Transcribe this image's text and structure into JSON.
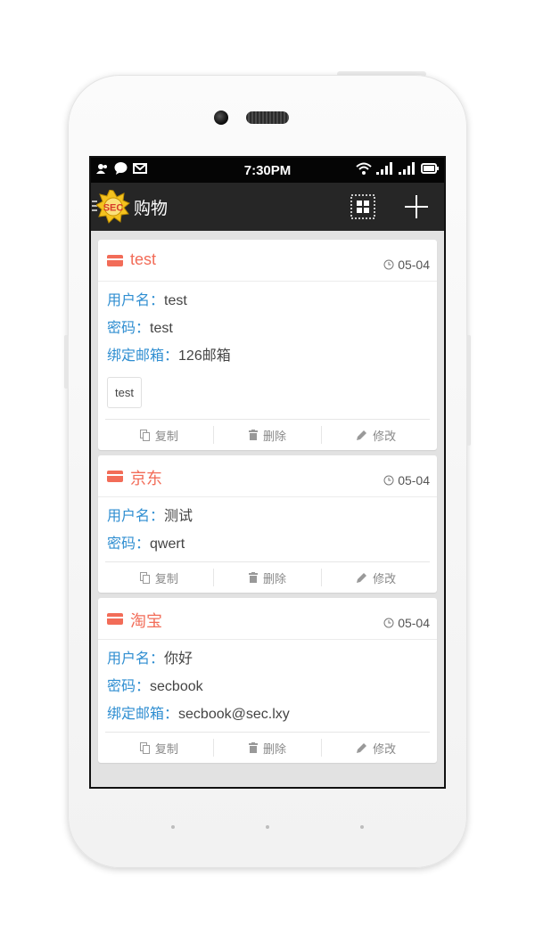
{
  "status_bar": {
    "time": "7:30PM"
  },
  "app_bar": {
    "title": "购物"
  },
  "actions": {
    "copy": "复制",
    "delete": "删除",
    "edit": "修改"
  },
  "cards": [
    {
      "title": "test",
      "date": "05-04",
      "username_label": "用户名：",
      "username": "test",
      "password_label": "密码：",
      "password": "test",
      "email_label": "绑定邮箱：",
      "email": "126邮箱",
      "tag": "test"
    },
    {
      "title": "京东",
      "date": "05-04",
      "username_label": "用户名：",
      "username": "测试",
      "password_label": "密码：",
      "password": "qwert"
    },
    {
      "title": "淘宝",
      "date": "05-04",
      "username_label": "用户名：",
      "username": "你好",
      "password_label": "密码：",
      "password": "secbook",
      "email_label": "绑定邮箱：",
      "email": "secbook@sec.lxy"
    }
  ],
  "colors": {
    "accent": "#f26c58",
    "label": "#2f8ed1",
    "appbar": "#262626"
  }
}
